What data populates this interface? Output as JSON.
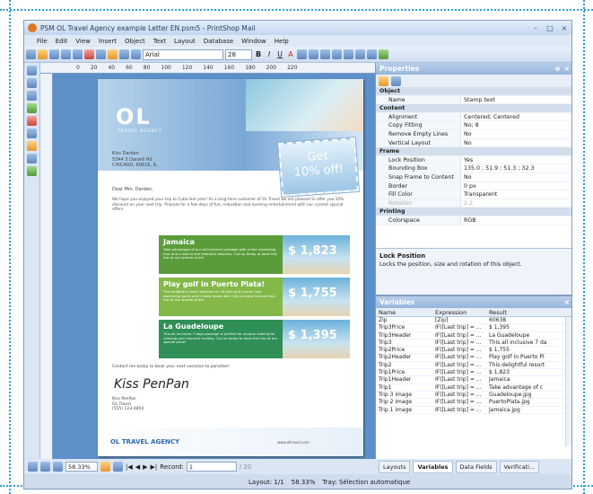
{
  "window": {
    "title": "PSM OL Travel Agency example Letter EN.psm5 - PrintShop Mail"
  },
  "menu": [
    "File",
    "Edit",
    "View",
    "Insert",
    "Object",
    "Text",
    "Layout",
    "Database",
    "Window",
    "Help"
  ],
  "toolbar": {
    "font": "Arial",
    "size": "28",
    "bold": "B",
    "italic": "I",
    "underline": "U",
    "color": "A"
  },
  "ruler": [
    "0",
    "20",
    "40",
    "60",
    "80",
    "100",
    "120",
    "140",
    "160",
    "180",
    "200",
    "220"
  ],
  "letter": {
    "logo": "OL",
    "logo_sub": "TRAVEL AGENCY",
    "stamp_line1": "Get",
    "stamp_line2": "10% off!",
    "address": [
      "Kiss Darden",
      "5344 S Darwill Rd",
      "CHICAGO, 60616, IL"
    ],
    "dear": "Dear Mrs. Darden,",
    "intro": "We hope you enjoyed your trip to Cuba last year! As a long-time customer of OL Travel we are pleased to offer you 10% discount on your next trip. Prepare for a few days of fun, relaxation and evening entertainment with our current special offers:",
    "offers": [
      {
        "title": "Jamaica",
        "price": "$ 1,823",
        "text": "Take advantage of our all-inclusive package with a free snorkeling tour and a visit to the beautiful beaches. Call us today to book this trip at our special price!"
      },
      {
        "title": "Play golf in Puerto Plata!",
        "price": "$ 1,755",
        "text": "This delightful resort features an 18-hole golf course, two swimming pools and a lively beach bar. Call us today to book this trip at our special price!"
      },
      {
        "title": "La Guadeloupe",
        "price": "$ 1,395",
        "text": "This all-inclusive 7 days package is perfect for anyone looking for relaxing and romantic holiday. Call us today to book this trip at our special price!"
      }
    ],
    "contact": "Contact me today to book your next vacation to paradise!",
    "signature": "Kiss PenPan",
    "signer": [
      "Kiss PenPan",
      "OL Travel",
      "(555) 123-4854"
    ],
    "footer_logo": "OL TRAVEL AGENCY",
    "footer_url": "www.oltravel.com"
  },
  "status": {
    "zoom": "58.33%",
    "record_label": "Record:",
    "record": "1",
    "total": "/ 20"
  },
  "bottom": {
    "layout": "Layout: 1/1",
    "zoom": "58.33%",
    "tray": "Tray: Sélection automatique"
  },
  "properties": {
    "title": "Properties",
    "rows": [
      {
        "sec": "Object"
      },
      {
        "k": "Name",
        "v": "Stamp text"
      },
      {
        "sec": "Content"
      },
      {
        "k": "Alignment",
        "v": "Centered; Centered"
      },
      {
        "k": "Copy Fitting",
        "v": "No; 8"
      },
      {
        "k": "Remove Empty Lines",
        "v": "No"
      },
      {
        "k": "Vertical Layout",
        "v": "No"
      },
      {
        "sec": "Frame"
      },
      {
        "k": "Lock Position",
        "v": "Yes"
      },
      {
        "k": "Bounding Box",
        "v": "135.0 ; 51.9 ; 51.3 ; 32.3"
      },
      {
        "k": "Snap Frame to Content",
        "v": "No"
      },
      {
        "k": "Border",
        "v": "0 px"
      },
      {
        "k": "Fill Color",
        "v": "Transparent"
      },
      {
        "k": "Rotation",
        "v": "2.2",
        "dis": true
      },
      {
        "sec": "Printing"
      },
      {
        "k": "Colorspace",
        "v": "RGB"
      }
    ],
    "help_title": "Lock Position",
    "help_text": "Locks the position, size and rotation of this object."
  },
  "variables": {
    "title": "Variables",
    "cols": [
      "Name",
      "Expression",
      "Result"
    ],
    "rows": [
      [
        "Zip",
        "[Zip]",
        "60638"
      ],
      [
        "Trip3Price",
        "IF([Last trip] = ...",
        "$ 1,395"
      ],
      [
        "Trip3Header",
        "IF([Last trip] = ...",
        "La Guadeloupe"
      ],
      [
        "Trip3",
        "IF([Last trip] = ...",
        "This all inclusive 7 da"
      ],
      [
        "Trip2Price",
        "IF([Last trip] = ...",
        "$ 1,755"
      ],
      [
        "Trip2Header",
        "IF([Last trip] = ...",
        "Play golf in Puerto Pl"
      ],
      [
        "Trip2",
        "IF([Last trip] = ...",
        "This delightful resort"
      ],
      [
        "Trip1Price",
        "IF([Last trip] = ...",
        "$ 1,823"
      ],
      [
        "Trip1Header",
        "IF([Last trip] = ...",
        "Jamaica"
      ],
      [
        "Trip1",
        "IF([Last trip] = ...",
        "Take advantage of c"
      ],
      [
        "Trip 3 image",
        "IF([Last trip] = ...",
        "Guadeloupe.jpg"
      ],
      [
        "Trip 2 image",
        "IF([Last trip] = ...",
        "PuertoPlata.jpg"
      ],
      [
        "Trip 1 image",
        "IF([Last trip] = ...",
        "Jamaica.jpg"
      ]
    ],
    "tabs": [
      "Layouts",
      "Variables",
      "Data Fields",
      "Verificati..."
    ]
  }
}
